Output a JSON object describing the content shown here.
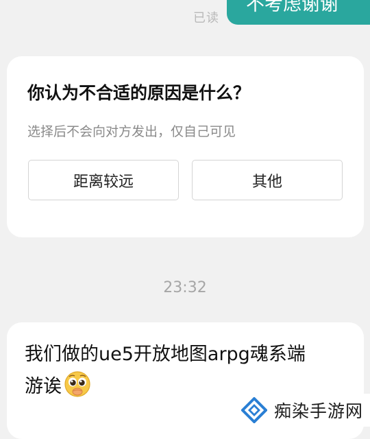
{
  "header": {
    "read_status": "已读",
    "sent_message": "不考虑谢谢"
  },
  "survey": {
    "title": "你认为不合适的原因是什么？",
    "subtitle": "选择后不会向对方发出，仅自己可见",
    "options": [
      "距离较远",
      "其他"
    ]
  },
  "timestamp": "23:32",
  "incoming_message": {
    "line1": "我们做的ue5开放地图arpg魂系端",
    "line2": "游诶",
    "emoji": "pleading-face-icon"
  },
  "watermark": {
    "text": "痴染手游网",
    "logo": "diamond-logo-icon",
    "logo_color": "#2a7fd4"
  },
  "colors": {
    "accent": "#2aa79e",
    "background": "#f1f1f1"
  }
}
